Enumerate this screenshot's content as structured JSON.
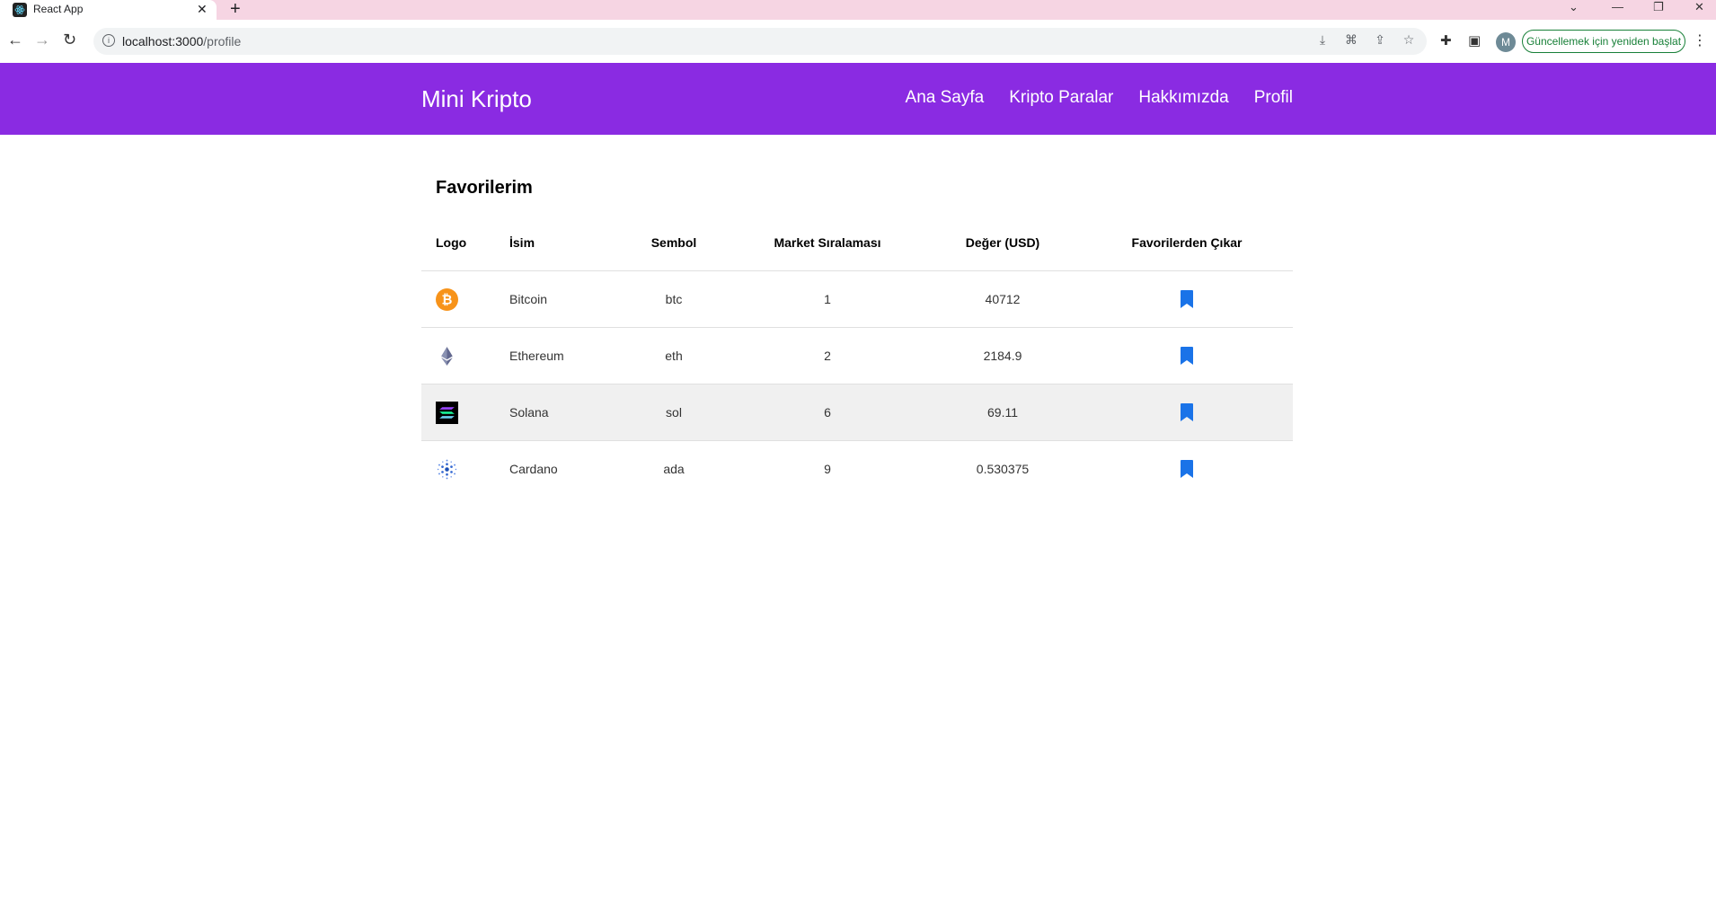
{
  "browser": {
    "tab_title": "React App",
    "url_host": "localhost:3000",
    "url_path": "/profile",
    "avatar_letter": "M",
    "update_button_label": "Güncellemek için yeniden başlat"
  },
  "navbar": {
    "brand": "Mini Kripto",
    "links": [
      "Ana Sayfa",
      "Kripto Paralar",
      "Hakkımızda",
      "Profil"
    ],
    "background": "#8a2be2"
  },
  "favorites": {
    "title": "Favorilerim",
    "columns": [
      "Logo",
      "İsim",
      "Sembol",
      "Market Sıralaması",
      "Değer (USD)",
      "Favorilerden Çıkar"
    ],
    "rows": [
      {
        "logo": "bitcoin-logo-icon",
        "name": "Bitcoin",
        "symbol": "btc",
        "rank": "1",
        "value": "40712"
      },
      {
        "logo": "ethereum-logo-icon",
        "name": "Ethereum",
        "symbol": "eth",
        "rank": "2",
        "value": "2184.9"
      },
      {
        "logo": "solana-logo-icon",
        "name": "Solana",
        "symbol": "sol",
        "rank": "6",
        "value": "69.11"
      },
      {
        "logo": "cardano-logo-icon",
        "name": "Cardano",
        "symbol": "ada",
        "rank": "9",
        "value": "0.530375"
      }
    ],
    "bookmark_color": "#1a73e8"
  }
}
